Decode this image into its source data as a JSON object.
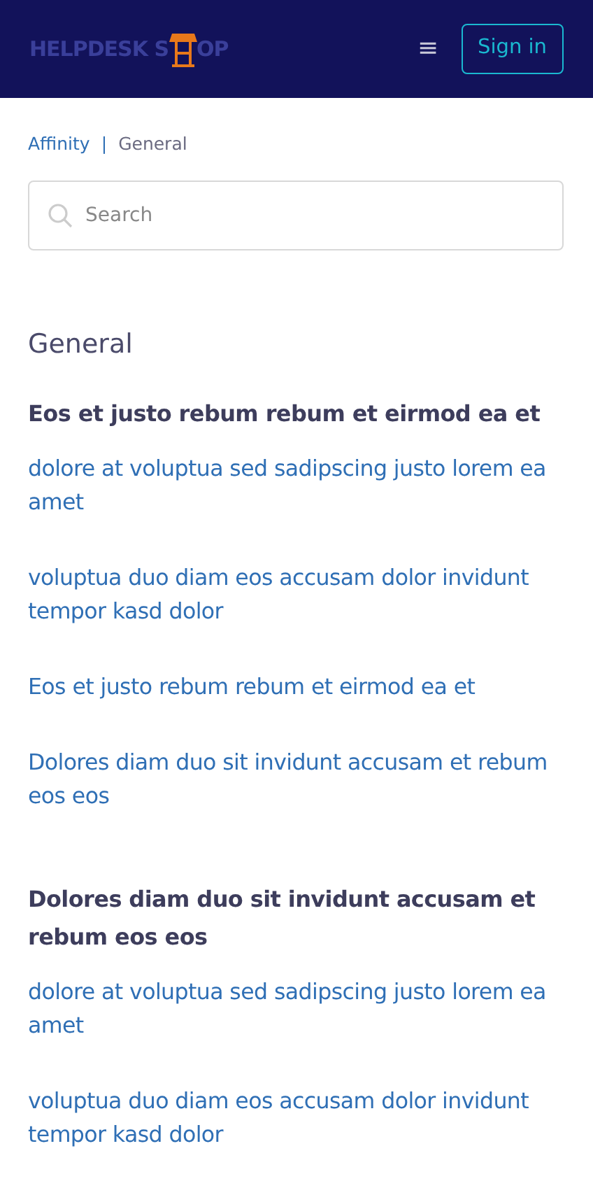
{
  "navbar": {
    "logo_parts": [
      "HELPDESK S",
      "OP"
    ],
    "menu_icon": "≡",
    "sign_in": "Sign in"
  },
  "breadcrumb": {
    "items": [
      "Affinity",
      "General"
    ],
    "separator": "|"
  },
  "search": {
    "placeholder": "Search"
  },
  "page_title": "General",
  "sections": [
    {
      "title": "Eos et justo rebum rebum et eirmod ea et",
      "links": [
        "dolore at voluptua sed sadipscing justo lorem ea amet",
        "voluptua duo diam eos accusam dolor invidunt tempor kasd dolor",
        "Eos et justo rebum rebum et eirmod ea et",
        "Dolores diam duo sit invidunt accusam et rebum eos eos"
      ]
    },
    {
      "title": "Dolores diam duo sit invidunt accusam et rebum eos eos",
      "links": [
        "dolore at voluptua sed sadipscing justo lorem ea amet",
        "voluptua duo diam eos accusam dolor invidunt tempor kasd dolor"
      ]
    }
  ]
}
